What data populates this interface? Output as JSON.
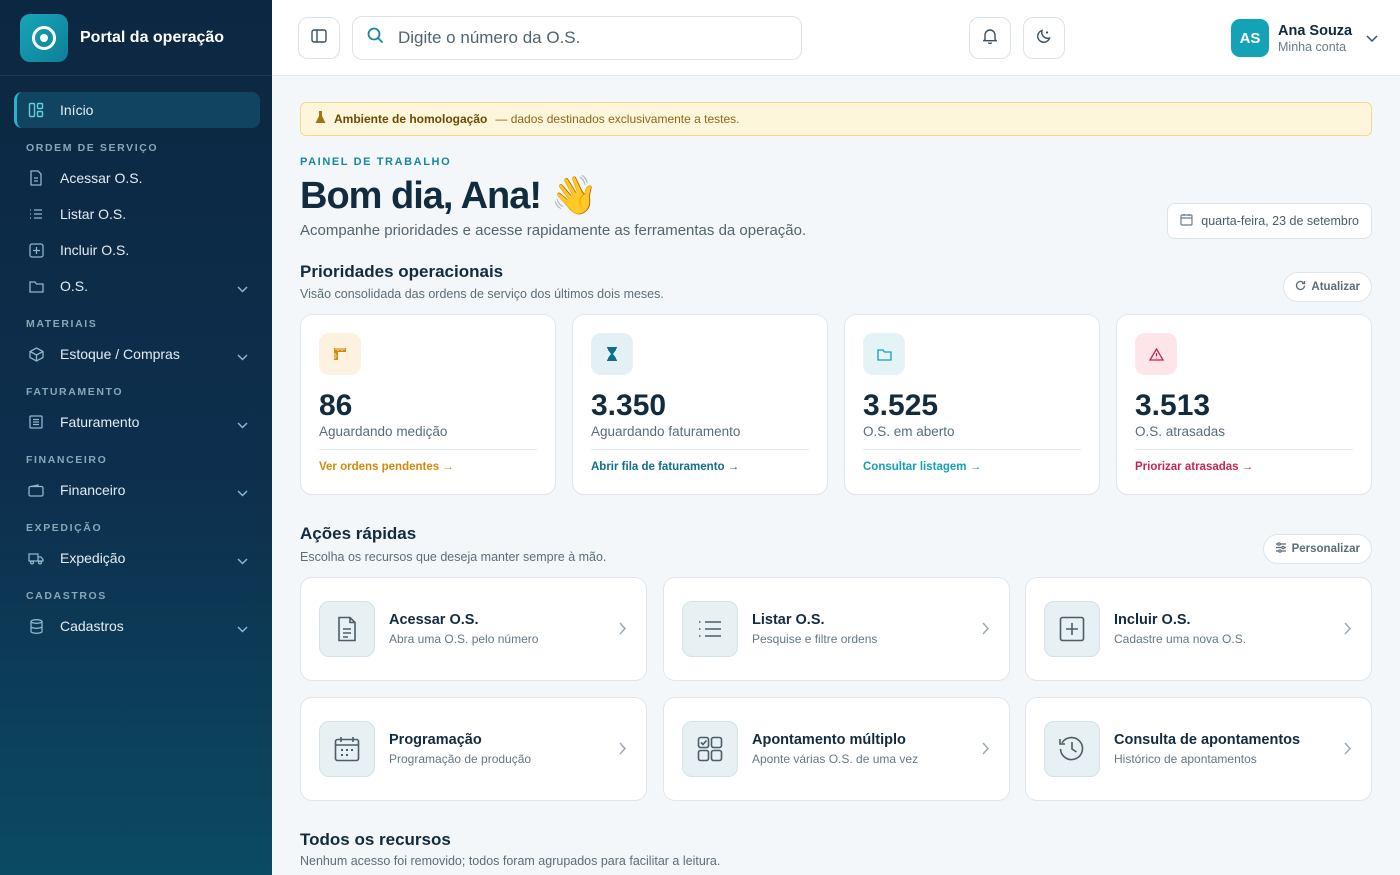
{
  "brand": {
    "title": "Portal da operação"
  },
  "sidebar": {
    "home": "Início",
    "sections": {
      "os": "ORDEM DE SERVIÇO",
      "materiais": "MATERIAIS",
      "faturamento": "FATURAMENTO",
      "financeiro": "FINANCEIRO",
      "expedicao": "EXPEDIÇÃO",
      "cadastros": "CADASTROS"
    },
    "items": {
      "acessar": "Acessar O.S.",
      "listar": "Listar O.S.",
      "incluir": "Incluir O.S.",
      "os": "O.S.",
      "estoque": "Estoque / Compras",
      "faturamento": "Faturamento",
      "financeiro": "Financeiro",
      "expedicao": "Expedição",
      "cadastros": "Cadastros"
    }
  },
  "topbar": {
    "search_placeholder": "Digite o número da O.S.",
    "user": {
      "initials": "AS",
      "name": "Ana Souza",
      "sub": "Minha conta"
    }
  },
  "banner": {
    "strong": "Ambiente de homologação",
    "rest": "— dados destinados exclusivamente a testes."
  },
  "header": {
    "eyebrow": "PAINEL DE TRABALHO",
    "greeting": "Bom dia, Ana! 👋",
    "subtitle": "Acompanhe prioridades e acesse rapidamente as ferramentas da operação.",
    "date": "quarta-feira, 23 de setembro"
  },
  "priorities": {
    "title": "Prioridades operacionais",
    "subtitle": "Visão consolidada das ordens de serviço dos últimos dois meses.",
    "refresh": "Atualizar",
    "cards": [
      {
        "value": "86",
        "label": "Aguardando medição",
        "link": "Ver ordens pendentes →",
        "color": "#d4880c",
        "bg": "#fdf1df"
      },
      {
        "value": "3.350",
        "label": "Aguardando faturamento",
        "link": "Abrir fila de faturamento →",
        "color": "#0f6e8c",
        "bg": "#e3f1f5"
      },
      {
        "value": "3.525",
        "label": "O.S. em aberto",
        "link": "Consultar listagem →",
        "color": "#14a0b3",
        "bg": "#e4f4f6"
      },
      {
        "value": "3.513",
        "label": "O.S. atrasadas",
        "link": "Priorizar atrasadas →",
        "color": "#c8264f",
        "bg": "#fde5ea"
      }
    ]
  },
  "quick": {
    "title": "Ações rápidas",
    "subtitle": "Escolha os recursos que deseja manter sempre à mão.",
    "customize": "Personalizar",
    "actions": [
      {
        "title": "Acessar O.S.",
        "sub": "Abra uma O.S. pelo número"
      },
      {
        "title": "Listar O.S.",
        "sub": "Pesquise e filtre ordens"
      },
      {
        "title": "Incluir O.S.",
        "sub": "Cadastre uma nova O.S."
      },
      {
        "title": "Programação",
        "sub": "Programação de produção"
      },
      {
        "title": "Apontamento múltiplo",
        "sub": "Aponte várias O.S. de uma vez"
      },
      {
        "title": "Consulta de apontamentos",
        "sub": "Histórico de apontamentos"
      }
    ]
  },
  "all": {
    "title": "Todos os recursos",
    "subtitle": "Nenhum acesso foi removido; todos foram agrupados para facilitar a leitura."
  }
}
